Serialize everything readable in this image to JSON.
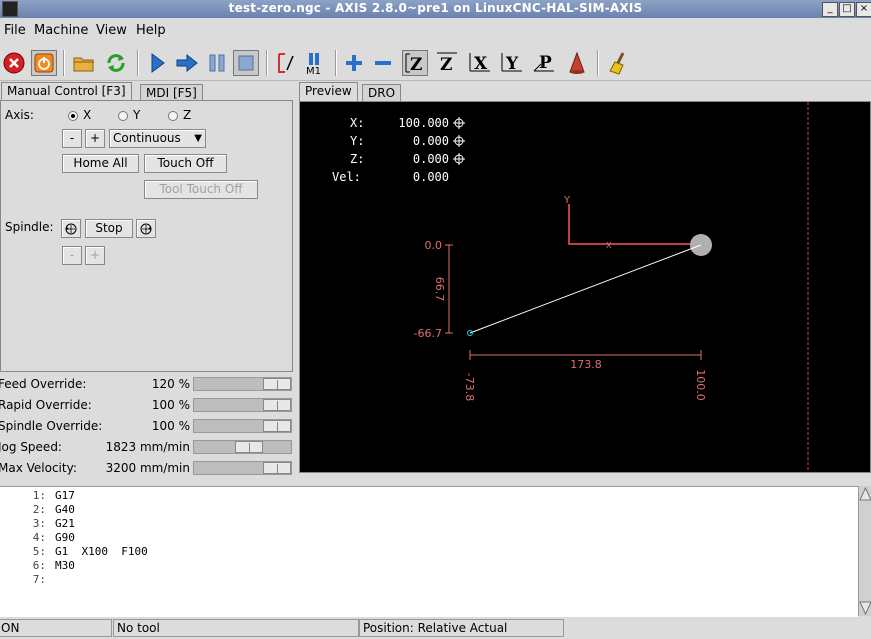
{
  "window": {
    "title": "test-zero.ngc - AXIS 2.8.0~pre1 on LinuxCNC-HAL-SIM-AXIS"
  },
  "menu": [
    "File",
    "Machine",
    "View",
    "Help"
  ],
  "toolbar": {
    "icons": [
      "estop-icon",
      "power-icon",
      "open-icon",
      "reload-icon",
      "run-icon",
      "step-icon",
      "pause-icon",
      "stop-icon",
      "block-delete-icon",
      "optional-stop-icon",
      "zoom-in-icon",
      "zoom-out-icon",
      "view-z-icon",
      "view-z2-icon",
      "view-x-icon",
      "view-y-icon",
      "view-p-icon",
      "rotate-icon",
      "clear-icon"
    ],
    "m1_label": "M1",
    "view_labels": {
      "z": "Z",
      "z2": "Z",
      "x": "X",
      "y": "Y",
      "p": "P"
    }
  },
  "left_tabs": [
    "Manual Control [F3]",
    "MDI [F5]"
  ],
  "manual": {
    "axis_label": "Axis:",
    "axes": [
      "X",
      "Y",
      "Z"
    ],
    "selected_axis": "X",
    "minus_label": "-",
    "plus_label": "+",
    "jog_mode": "Continuous",
    "home_all": "Home All",
    "touch_off": "Touch Off",
    "tool_touch_off": "Tool Touch Off",
    "spindle_label": "Spindle:",
    "spindle_stop": "Stop",
    "spindle_minus": "-",
    "spindle_plus": "+"
  },
  "sliders": [
    {
      "label": "Feed Override:",
      "value": "120 %",
      "fraction": 1.0
    },
    {
      "label": "Rapid Override:",
      "value": "100 %",
      "fraction": 1.0
    },
    {
      "label": "Spindle Override:",
      "value": "100 %",
      "fraction": 1.0
    },
    {
      "label": "Jog Speed:",
      "value": "1823 mm/min",
      "fraction": 0.6
    },
    {
      "label": "Max Velocity:",
      "value": "3200 mm/min",
      "fraction": 1.0
    }
  ],
  "preview_tabs": [
    "Preview",
    "DRO"
  ],
  "dro": [
    {
      "axis": "X:",
      "value": "100.000"
    },
    {
      "axis": "Y:",
      "value": "0.000"
    },
    {
      "axis": "Z:",
      "value": "0.000"
    },
    {
      "axis": "Vel:",
      "value": "0.000"
    }
  ],
  "plot": {
    "y_top": "0.0",
    "y_bottom": "-66.7",
    "y_span": "66.7",
    "x_span": "173.8",
    "x_left": "-73.8",
    "x_right": "100.0",
    "axis_y": "Y",
    "axis_x": "X"
  },
  "gcode": [
    {
      "n": "1:",
      "text": "G17"
    },
    {
      "n": "2:",
      "text": "G40"
    },
    {
      "n": "3:",
      "text": "G21"
    },
    {
      "n": "4:",
      "text": "G90"
    },
    {
      "n": "5:",
      "text": "G1  X100  F100"
    },
    {
      "n": "6:",
      "text": "M30"
    },
    {
      "n": "7:",
      "text": ""
    }
  ],
  "status": {
    "state": "ON",
    "tool": "No tool",
    "position": "Position: Relative Actual"
  },
  "colors": {
    "plot_red": "#e07070",
    "path_white": "#ffffff",
    "tool_gray": "#b0b0b0",
    "cyan": "#00e0e0"
  }
}
